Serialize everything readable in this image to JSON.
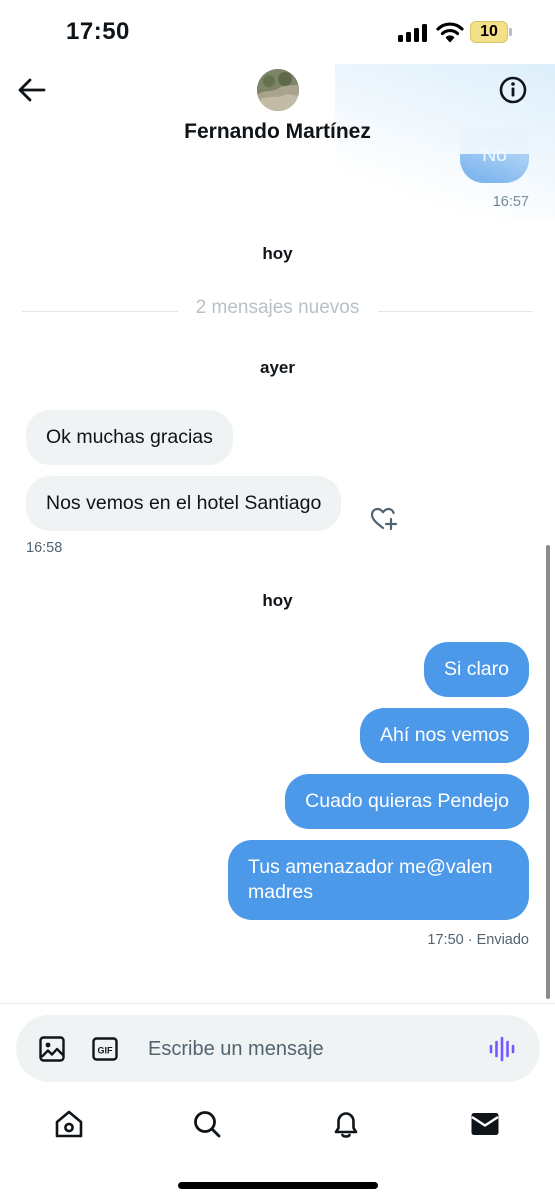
{
  "status_bar": {
    "time": "17:50",
    "battery": "10"
  },
  "header": {
    "contact_name": "Fernando Martínez",
    "back_icon": "arrow-left-icon",
    "info_icon": "info-circle-icon",
    "avatar": "contact-avatar"
  },
  "conversation": {
    "top_message": {
      "text": "No",
      "time": "16:57"
    },
    "day_label_today_1": "hoy",
    "new_messages_divider": "2 mensajes nuevos",
    "day_label_yesterday": "ayer",
    "incoming": [
      {
        "text": "Ok muchas gracias"
      },
      {
        "text": "Nos vemos en el hotel Santiago"
      }
    ],
    "incoming_time": "16:58",
    "reaction_icon": "heart-plus-icon",
    "day_label_today_2": "hoy",
    "outgoing": [
      {
        "text": "Si claro"
      },
      {
        "text": "Ahí nos vemos"
      },
      {
        "text": "Cuado quieras Pendejo"
      },
      {
        "text": "Tus amenazador me@valen madres"
      }
    ],
    "outgoing_time": "17:50",
    "outgoing_status": "· Enviado"
  },
  "composer": {
    "placeholder": "Escribe un mensaje",
    "media_icon": "image-icon",
    "gif_icon": "gif-icon",
    "voice_icon": "voice-waveform-icon"
  },
  "nav": {
    "items": [
      "home-icon",
      "search-icon",
      "bell-icon",
      "mail-icon"
    ]
  },
  "colors": {
    "outgoing_bubble": "#4c98e9",
    "incoming_bubble": "#eff3f4",
    "voice_icon": "#7856ff"
  }
}
